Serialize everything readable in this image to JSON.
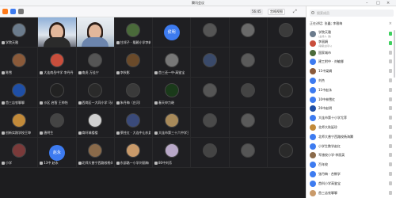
{
  "window": {
    "title": "腾讯会议"
  },
  "toolbar": {
    "timer": "56:45",
    "layout_label": "宫格视图",
    "expand_icon": "expand-icon"
  },
  "search": {
    "placeholder": "搜索成员"
  },
  "panel": {
    "header": "正在讲话: 张鑫; 李雅梅"
  },
  "tiles": [
    {
      "name": "学院天雅",
      "avatar": "#6b7b8c"
    },
    {
      "name": "",
      "video": "teacher"
    },
    {
      "name": "",
      "video": "speaker"
    },
    {
      "name": "甘邦子 · 隆赖小学李峰",
      "avatar": "#4a6a3a"
    },
    {
      "name": "",
      "badge": "侯明",
      "avatar": "#3d7bf0"
    },
    {
      "name": "",
      "avatar": "#555"
    },
    {
      "name": "",
      "avatar": "#6a6a6a"
    },
    {
      "name": "",
      "avatar": "#3b3b3b"
    },
    {
      "name": "陈雪",
      "avatar": "#8a5a3a"
    },
    {
      "name": "大连南岳中学 李丹丹",
      "avatar": "#c94e3c"
    },
    {
      "name": "南虎 万佳宁",
      "avatar": "#555"
    },
    {
      "name": "李秋影",
      "avatar": "#6a4a2a"
    },
    {
      "name": "首三还一中·高鉴宝",
      "avatar": "#777"
    },
    {
      "name": "",
      "avatar": "#3a4a6a"
    },
    {
      "name": "",
      "avatar": "#5a5a5a"
    },
    {
      "name": "",
      "avatar": "#2f2f2f"
    },
    {
      "name": "首三店农聊聊",
      "avatar": "#1f4fa6"
    },
    {
      "name": "沙区 启智 王帅怡",
      "avatar": "#222"
    },
    {
      "name": "西岗区一大同小学 马红梅",
      "avatar": "#2a2a2a"
    },
    {
      "name": "朱丹梅（庄河）",
      "avatar": "#3a3a3a"
    },
    {
      "name": "春天申力继",
      "avatar": "#1a3a1a"
    },
    {
      "name": "",
      "avatar": "#555"
    },
    {
      "name": "",
      "avatar": "#444"
    },
    {
      "name": "",
      "avatar": "#2a2a2a"
    },
    {
      "name": "创新实践学校王坤",
      "avatar": "#c28a3a"
    },
    {
      "name": "唐明生",
      "avatar": "#444"
    },
    {
      "name": "育轩城楼楼",
      "avatar": "#d0d0d0"
    },
    {
      "name": "莱柱红 · 大连中山东路",
      "avatar": "#3a4a7a"
    },
    {
      "name": "大连市第三十六中学王赫东",
      "avatar": "#a88a5a"
    },
    {
      "name": "",
      "avatar": "#4a4a4a"
    },
    {
      "name": "",
      "avatar": "#5a5a5a"
    },
    {
      "name": "",
      "avatar": "#333"
    },
    {
      "name": "小学",
      "avatar": "#7a3a3a"
    },
    {
      "name": "13中 赵永",
      "badge": "赵永",
      "avatar": "#3d7bf0"
    },
    {
      "name": "北师大普宁西路校杨海腾",
      "avatar": "#8a6a4a"
    },
    {
      "name": "东部路一小学刘丽梅",
      "avatar": "#c99a6a"
    },
    {
      "name": "80中刘芳",
      "avatar": "#b8a8c8"
    },
    {
      "name": "",
      "avatar": "#444"
    },
    {
      "name": "",
      "avatar": "#555"
    },
    {
      "name": "",
      "avatar": "#2a2a2a"
    }
  ],
  "members": [
    {
      "name": "学院天雅",
      "sub": "(主持人, 我)",
      "color": "#6b7b8c",
      "state": "bar"
    },
    {
      "name": "李丽娟",
      "sub": "(联席主持人)",
      "color": "#c94e3c",
      "state": "bar"
    },
    {
      "name": "国家城市",
      "sub": "",
      "color": "#4a6a3a",
      "state": ""
    },
    {
      "name": "建工附中 · 刘敏娜",
      "sub": "",
      "color": "#3d7bf0",
      "state": ""
    },
    {
      "name": "11中梁娟",
      "sub": "",
      "color": "#8a5a3a",
      "state": ""
    },
    {
      "name": "刘杰",
      "sub": "",
      "color": "#3d7bf0",
      "state": ""
    },
    {
      "name": "11中赵永",
      "sub": "",
      "color": "#3d7bf0",
      "state": ""
    },
    {
      "name": "10中林雪红",
      "sub": "",
      "color": "#3d7bf0",
      "state": ""
    },
    {
      "name": "26中赵明",
      "sub": "",
      "color": "#1f4fa6",
      "state": ""
    },
    {
      "name": "大连市第十小学尤菲",
      "sub": "",
      "color": "#3d7bf0",
      "state": ""
    },
    {
      "name": "北师大秋延珍",
      "sub": "",
      "color": "#c28a3a",
      "state": ""
    },
    {
      "name": "北师大普宁西路校杨海腾",
      "sub": "",
      "color": "#3d7bf0",
      "state": ""
    },
    {
      "name": "小学生数学赵红",
      "sub": "",
      "color": "#3d7bf0",
      "state": ""
    },
    {
      "name": "军旅校小学·李丽英",
      "sub": "",
      "color": "#8a6a4a",
      "state": ""
    },
    {
      "name": "百年校",
      "sub": "",
      "color": "#3d7bf0",
      "state": ""
    },
    {
      "name": "张丹梅 · 合教学",
      "sub": "",
      "color": "#3d7bf0",
      "state": ""
    },
    {
      "name": "首科小学高鉴宝",
      "sub": "",
      "color": "#3d7bf0",
      "state": ""
    },
    {
      "name": "首三店农聊聊",
      "sub": "",
      "color": "#c99a6a",
      "state": ""
    }
  ]
}
